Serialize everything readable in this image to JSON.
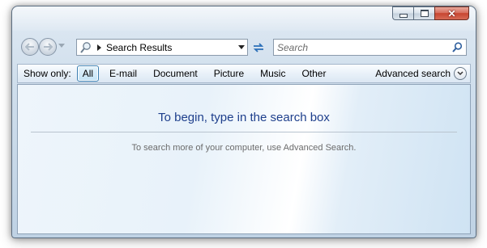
{
  "window": {
    "caption": {
      "minimize": "—",
      "maximize": "□",
      "close": "✕"
    }
  },
  "nav": {
    "back_icon": "back-arrow-icon",
    "forward_icon": "forward-arrow-icon",
    "address": {
      "location": "Search Results"
    },
    "search": {
      "placeholder": "Search"
    }
  },
  "filter": {
    "label": "Show only:",
    "items": [
      {
        "label": "All",
        "active": true
      },
      {
        "label": "E-mail"
      },
      {
        "label": "Document"
      },
      {
        "label": "Picture"
      },
      {
        "label": "Music"
      },
      {
        "label": "Other"
      }
    ],
    "advanced": "Advanced search"
  },
  "content": {
    "title": "To begin, type in the search box",
    "subtitle": "To search more of your computer, use Advanced Search."
  },
  "colors": {
    "title_text": "#1e3f8c",
    "close_button": "#c74530",
    "active_filter_border": "#3c7fb1"
  }
}
